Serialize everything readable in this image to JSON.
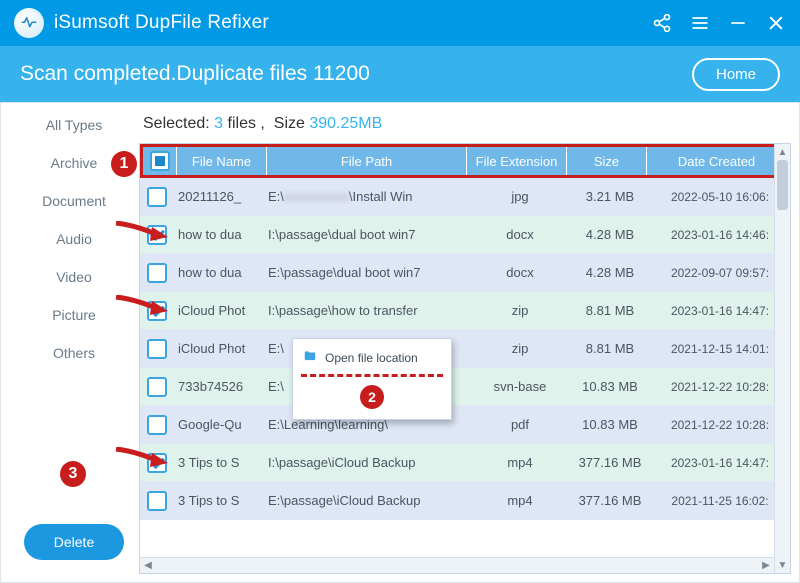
{
  "app": {
    "title": "iSumsoft DupFile Refixer"
  },
  "subheader": {
    "status": "Scan completed.Duplicate files 11200",
    "home": "Home"
  },
  "selection": {
    "label_prefix": "Selected:",
    "files_count": "3",
    "files_word": "files ,",
    "size_label": "Size",
    "size_value": "390.25MB"
  },
  "sidebar": {
    "items": [
      {
        "label": "All Types"
      },
      {
        "label": "Archive"
      },
      {
        "label": "Document"
      },
      {
        "label": "Audio"
      },
      {
        "label": "Video"
      },
      {
        "label": "Picture"
      },
      {
        "label": "Others"
      }
    ],
    "delete": "Delete"
  },
  "columns": {
    "name": "File Name",
    "path": "File Path",
    "ext": "File Extension",
    "size": "Size",
    "date": "Date Created"
  },
  "rows": [
    {
      "checked": false,
      "name": "20211126_",
      "path": "E:\\                    \\Install Win",
      "path_blur": true,
      "ext": "jpg",
      "size": "3.21 MB",
      "date": "2022-05-10 16:06:"
    },
    {
      "checked": true,
      "name": "how to dua",
      "path": "I:\\passage\\dual boot win7",
      "ext": "docx",
      "size": "4.28 MB",
      "date": "2023-01-16 14:46:"
    },
    {
      "checked": false,
      "name": "how to dua",
      "path": "E:\\passage\\dual boot win7",
      "ext": "docx",
      "size": "4.28 MB",
      "date": "2022-09-07 09:57:"
    },
    {
      "checked": true,
      "name": "iCloud Phot",
      "path": "I:\\passage\\how to transfer",
      "ext": "zip",
      "size": "8.81 MB",
      "date": "2023-01-16 14:47:"
    },
    {
      "checked": false,
      "name": "iCloud Phot",
      "path": "E:\\",
      "ext": "zip",
      "size": "8.81 MB",
      "date": "2021-12-15 14:01:"
    },
    {
      "checked": false,
      "name": "733b74526",
      "path": "E:\\",
      "ext": "svn-base",
      "size": "10.83 MB",
      "date": "2021-12-22 10:28:"
    },
    {
      "checked": false,
      "name": "Google-Qu",
      "path": "E:\\Learning\\learning\\",
      "ext": "pdf",
      "size": "10.83 MB",
      "date": "2021-12-22 10:28:"
    },
    {
      "checked": true,
      "name": "3 Tips to S",
      "path": "I:\\passage\\iCloud Backup",
      "ext": "mp4",
      "size": "377.16 MB",
      "date": "2023-01-16 14:47:"
    },
    {
      "checked": false,
      "name": "3 Tips to S",
      "path": "E:\\passage\\iCloud Backup",
      "ext": "mp4",
      "size": "377.16 MB",
      "date": "2021-11-25 16:02:"
    }
  ],
  "context_menu": {
    "open_location": "Open file location"
  },
  "annotations": {
    "n1": "1",
    "n2": "2",
    "n3": "3"
  }
}
